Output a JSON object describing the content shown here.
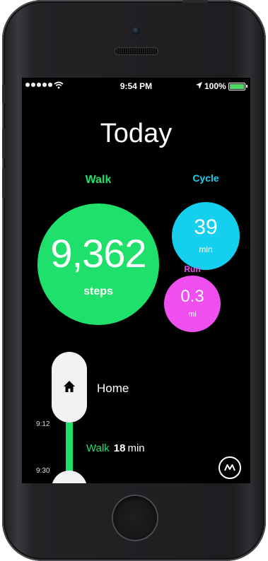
{
  "status_bar": {
    "time": "9:54 PM",
    "battery_percent": "100%",
    "battery_level": 1.0
  },
  "header": {
    "title": "Today"
  },
  "activities": {
    "walk": {
      "label": "Walk",
      "value": "9,362",
      "unit": "steps",
      "color": "#1fe06a"
    },
    "cycle": {
      "label": "Cycle",
      "value": "39",
      "unit": "min",
      "color": "#14cfee"
    },
    "run": {
      "label": "Run",
      "value": "0.3",
      "unit": "mi",
      "color": "#ef4fee"
    }
  },
  "timeline": {
    "place": {
      "label": "Home",
      "icon": "home-icon"
    },
    "times": [
      "9:12",
      "9:30"
    ],
    "segment": {
      "activity": "Walk",
      "duration": "18",
      "unit": "min"
    }
  },
  "app_logo": {
    "icon": "moves-logo-icon"
  }
}
